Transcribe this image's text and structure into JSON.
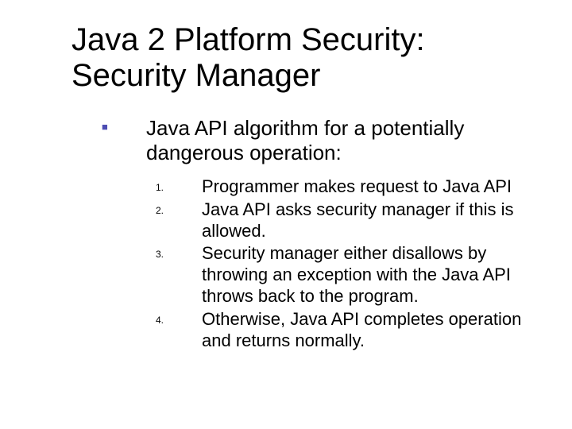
{
  "title": "Java 2 Platform Security: Security Manager",
  "intro": "Java API algorithm for a potentially dangerous operation:",
  "steps": {
    "n1": "1.",
    "t1": "Programmer makes request to Java API",
    "n2": "2.",
    "t2": "Java API asks security manager if this is allowed.",
    "n3": "3.",
    "t3": "Security manager either disallows by throwing an exception with the Java API throws back to the program.",
    "n4": "4.",
    "t4": "Otherwise, Java API completes operation and returns normally."
  }
}
